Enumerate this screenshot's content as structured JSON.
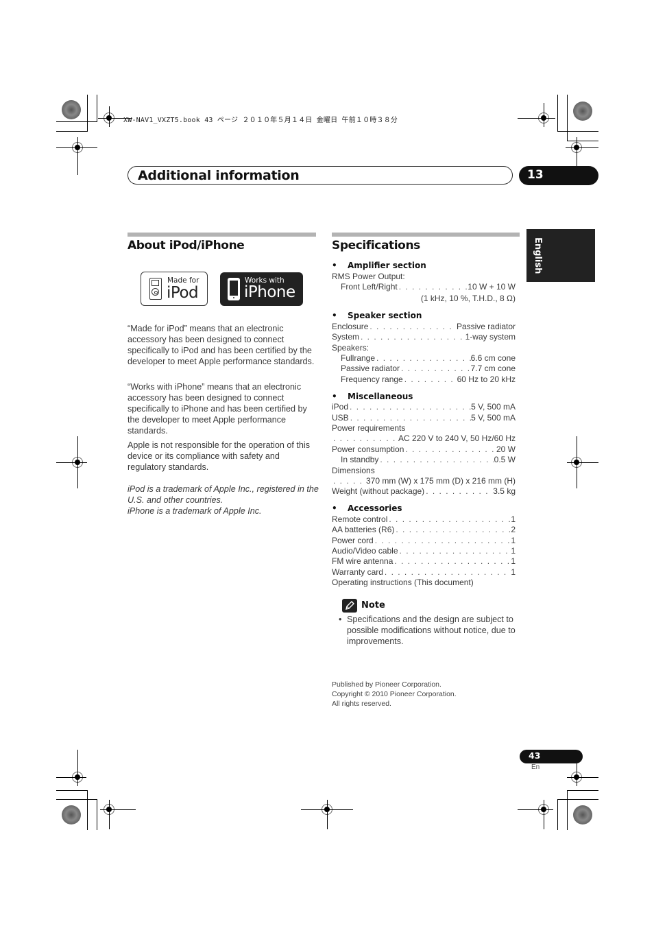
{
  "print_header": "XW-NAV1_VXZT5.book  43 ページ  ２０１０年５月１４日  金曜日  午前１０時３８分",
  "chapter": {
    "title": "Additional information",
    "number": "13"
  },
  "side_tab": {
    "language": "English"
  },
  "about": {
    "title": "About iPod/iPhone",
    "logos": {
      "ipod": {
        "small": "Made for",
        "big": "iPod",
        "icon": "ipod-icon"
      },
      "iphone": {
        "small": "Works with",
        "big": "iPhone",
        "icon": "iphone-icon"
      }
    },
    "paragraphs": [
      "“Made for iPod” means that an electronic accessory has been designed to connect specifically to iPod and has been certified by the developer to meet Apple performance standards.",
      "“Works with iPhone” means that an electronic accessory has been designed to connect specifically to iPhone and has been certified by the developer to meet Apple performance standards.",
      "Apple is not responsible for the operation of this device or its compliance with safety and regulatory standards."
    ],
    "trademarks": [
      "iPod is a trademark of Apple Inc., registered in the U.S. and other countries.",
      "iPhone is a trademark of Apple Inc."
    ]
  },
  "specifications": {
    "title": "Specifications",
    "amplifier": {
      "heading": "Amplifier section",
      "rms_label": "RMS Power Output:",
      "front_label": "Front Left/Right",
      "front_value": "10 W + 10 W",
      "front_condition": "(1 kHz, 10 %, T.H.D., 8 Ω)"
    },
    "speaker": {
      "heading": "Speaker section",
      "rows": [
        {
          "label": "Enclosure",
          "value": "Passive radiator"
        },
        {
          "label": "System",
          "value": "1-way system"
        }
      ],
      "speakers_label": "Speakers:",
      "sub_rows": [
        {
          "label": "Fullrange",
          "value": "6.6 cm cone"
        },
        {
          "label": "Passive radiator",
          "value": "7.7 cm cone"
        },
        {
          "label": "Frequency range",
          "value": "60 Hz to 20 kHz"
        }
      ]
    },
    "misc": {
      "heading": "Miscellaneous",
      "ipod": {
        "label": "iPod",
        "value": "5 V, 500 mA"
      },
      "usb": {
        "label": "USB",
        "value": "5 V, 500 mA"
      },
      "power_req_label": "Power requirements",
      "power_req_value": "AC 220 V to 240 V, 50 Hz/60 Hz",
      "power_cons": {
        "label": "Power consumption",
        "value": "20 W"
      },
      "standby": {
        "label": "In standby",
        "value": "0.5 W"
      },
      "dimensions_label": "Dimensions",
      "dimensions_value": "370 mm (W) x 175 mm (D) x 216 mm (H)",
      "weight": {
        "label": "Weight (without package)",
        "value": "3.5 kg"
      }
    },
    "accessories": {
      "heading": "Accessories",
      "rows": [
        {
          "label": "Remote control",
          "value": "1"
        },
        {
          "label": "AA batteries (R6)",
          "value": "2"
        },
        {
          "label": "Power cord",
          "value": "1"
        },
        {
          "label": "Audio/Video cable",
          "value": "1"
        },
        {
          "label": "FM wire antenna",
          "value": "1"
        },
        {
          "label": "Warranty card",
          "value": "1"
        }
      ],
      "last": "Operating instructions (This document)"
    }
  },
  "note": {
    "title": "Note",
    "icon": "pencil-icon",
    "bullet": "•",
    "text": "Specifications and the design are subject to possible modifications without notice, due to improvements."
  },
  "publisher": {
    "line1": "Published by Pioneer Corporation.",
    "line2": "Copyright © 2010 Pioneer Corporation.",
    "line3": "All rights reserved."
  },
  "footer": {
    "page_number": "43",
    "page_lang": "En"
  },
  "dots": ". . . . . . . . . . . . . . . . . . . . . . . . . . . . . . . . . . . . . . . . . . . . . . . . . . . . . ."
}
